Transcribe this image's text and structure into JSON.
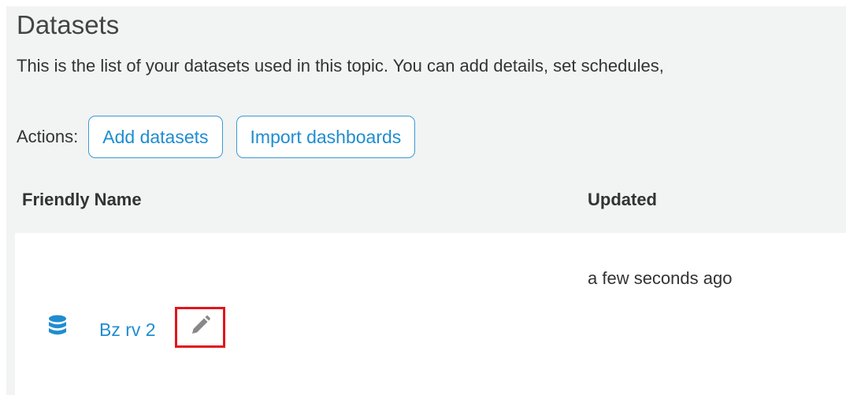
{
  "header": {
    "title": "Datasets",
    "description": "This is the list of your datasets used in this topic. You can add details, set schedules,"
  },
  "actions": {
    "label": "Actions:",
    "add_datasets": "Add datasets",
    "import_dashboards": "Import dashboards"
  },
  "table": {
    "columns": {
      "friendly_name": "Friendly Name",
      "updated": "Updated"
    },
    "rows": [
      {
        "name": "Bz rv 2",
        "updated": "a few seconds ago",
        "icon": "database-icon"
      }
    ]
  },
  "colors": {
    "accent": "#1f8dd0",
    "panel_bg": "#f2f3f3",
    "highlight": "#e0161b",
    "icon_gray": "#888888"
  }
}
